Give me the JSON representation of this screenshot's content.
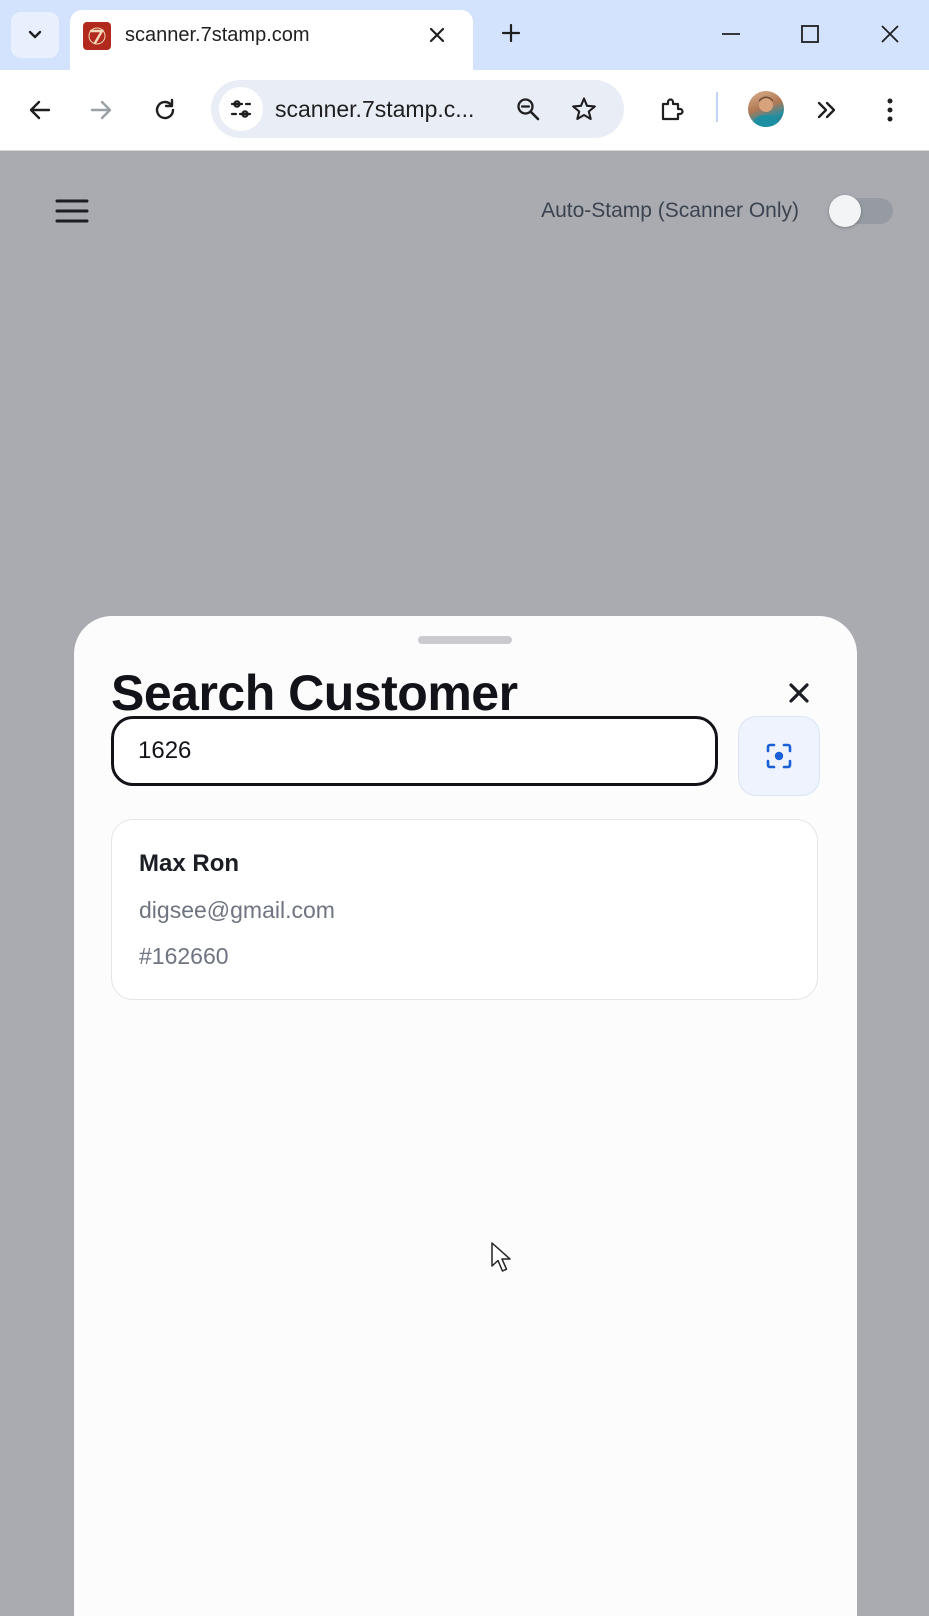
{
  "browser": {
    "tab": {
      "title": "scanner.7stamp.com",
      "favicon": "7stamp-logo-icon"
    },
    "omnibox": {
      "url": "scanner.7stamp.c..."
    },
    "icons": {
      "tab_search": "chevron-down-icon",
      "tab_close": "close-icon",
      "new_tab": "plus-icon",
      "minimize": "minimize-icon",
      "maximize": "maximize-icon",
      "close_window": "close-icon",
      "back": "back-arrow-icon",
      "forward": "forward-arrow-icon",
      "reload": "reload-icon",
      "site_info": "tune-icon",
      "zoom": "zoom-out-icon",
      "bookmark": "star-icon",
      "extensions": "puzzle-icon",
      "more_tools": "double-chevron-icon",
      "menu": "kebab-menu-icon"
    }
  },
  "app": {
    "auto_stamp_label": "Auto-Stamp (Scanner Only)",
    "auto_stamp_enabled": false,
    "menu_icon": "hamburger-icon"
  },
  "sheet": {
    "title": "Search Customer",
    "search_value": "1626",
    "scan_icon": "scan-focus-icon",
    "close_icon": "close-icon",
    "results": [
      {
        "name": "Max Ron",
        "email": "digsee@gmail.com",
        "id": "#162660"
      }
    ]
  },
  "colors": {
    "tabstrip": "#d3e3fd",
    "overlay": "#a9abb1",
    "accent_blue": "#1a5fd6",
    "sheet_bg": "#fcfcfd"
  }
}
